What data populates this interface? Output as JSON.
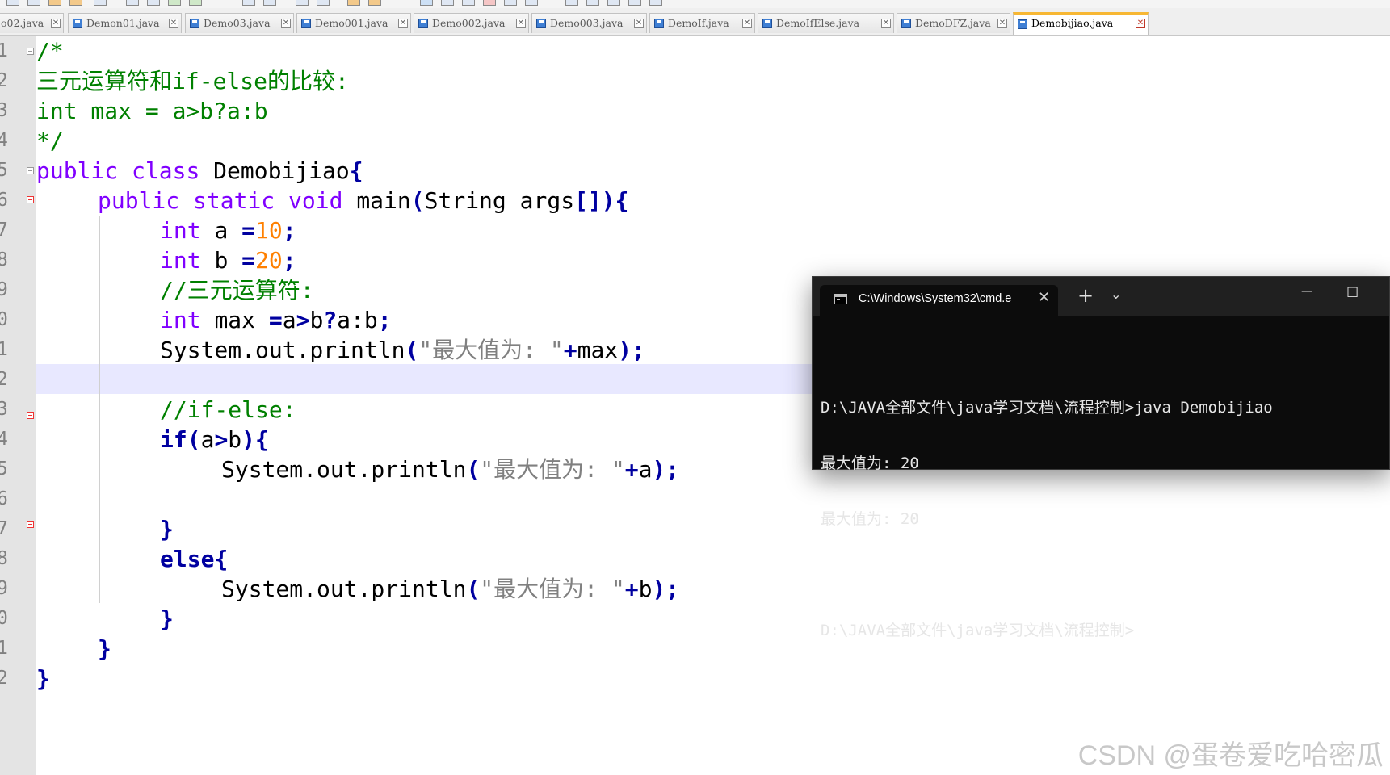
{
  "tabs": [
    {
      "label": "o02.java"
    },
    {
      "label": "Demon01.java"
    },
    {
      "label": "Demo03.java"
    },
    {
      "label": "Demo001.java"
    },
    {
      "label": "Demo002.java"
    },
    {
      "label": "Demo003.java"
    },
    {
      "label": "DemoIf.java"
    },
    {
      "label": "DemoIfElse.java"
    },
    {
      "label": "DemoDFZ.java"
    },
    {
      "label": "Demobijiao.java",
      "active": true
    }
  ],
  "line_numbers": [
    "1",
    "2",
    "3",
    "4",
    "5",
    "6",
    "7",
    "8",
    "9",
    "0",
    "1",
    "2",
    "3",
    "4",
    "5",
    "6",
    "7",
    "8",
    "9",
    "0",
    "1",
    "2"
  ],
  "code": {
    "l1": "/*",
    "l2": "三元运算符和if-else的比较:",
    "l3": "int max = a>b?a:b",
    "l4": "*/",
    "l5_kw1": "public",
    "l5_kw2": "class",
    "l5_rest": "Demobijiao",
    "l5_brace": "{",
    "l6_kw1": "public",
    "l6_kw2": "static",
    "l6_kw3": "void",
    "l6_name": "main",
    "l6_p1": "(",
    "l6_arg": "String args",
    "l6_p2": "[]){",
    "l7_kw": "int",
    "l7_var": "a ",
    "l7_op": "=",
    "l7_num": "10",
    "l7_end": ";",
    "l8_kw": "int",
    "l8_var": "b ",
    "l8_op": "=",
    "l8_num": "20",
    "l8_end": ";",
    "l9": "//三元运算符:",
    "l10_kw": "int",
    "l10_var": "max ",
    "l10_op": "=",
    "l10_rest1": "a",
    "l10_gt": ">",
    "l10_rest2": "b",
    "l10_q": "?",
    "l10_rest3": "a:b",
    "l10_end": ";",
    "l11_call": "System.out.println",
    "l11_p1": "(",
    "l11_str": "\"最大值为: \"",
    "l11_plus": "+",
    "l11_var": "max",
    "l11_p2": ");",
    "l13": "//if-else:",
    "l14_kw": "if",
    "l14_p1": "(",
    "l14_cond1": "a",
    "l14_gt": ">",
    "l14_cond2": "b",
    "l14_p2": "){",
    "l15_call": "System.out.println",
    "l15_p1": "(",
    "l15_str": "\"最大值为: \"",
    "l15_plus": "+",
    "l15_var": "a",
    "l15_p2": ");",
    "l17": "}",
    "l18_kw": "else",
    "l18_brace": "{",
    "l19_call": "System.out.println",
    "l19_p1": "(",
    "l19_str": "\"最大值为: \"",
    "l19_plus": "+",
    "l19_var": "b",
    "l19_p2": ");",
    "l20": "}",
    "l21": "}",
    "l22": "}"
  },
  "cmd": {
    "tab_title": "C:\\Windows\\System32\\cmd.e",
    "close_glyph": "✕",
    "new_tab_glyph": "+",
    "dropdown_glyph": "⌄",
    "minimize_glyph": "—",
    "maximize_glyph": "☐",
    "lines": [
      "D:\\JAVA全部文件\\java学习文档\\流程控制>java Demobijiao",
      "最大值为: 20",
      "最大值为: 20",
      "",
      "D:\\JAVA全部文件\\java学习文档\\流程控制>"
    ]
  },
  "watermark": "CSDN @蛋卷爱吃哈密瓜",
  "colors": {
    "comment": "#008000",
    "keyword": "#8000ff",
    "bold_operator": "#0000a0",
    "number": "#ff8000",
    "string": "#808080",
    "current_line": "#e8e8ff"
  }
}
